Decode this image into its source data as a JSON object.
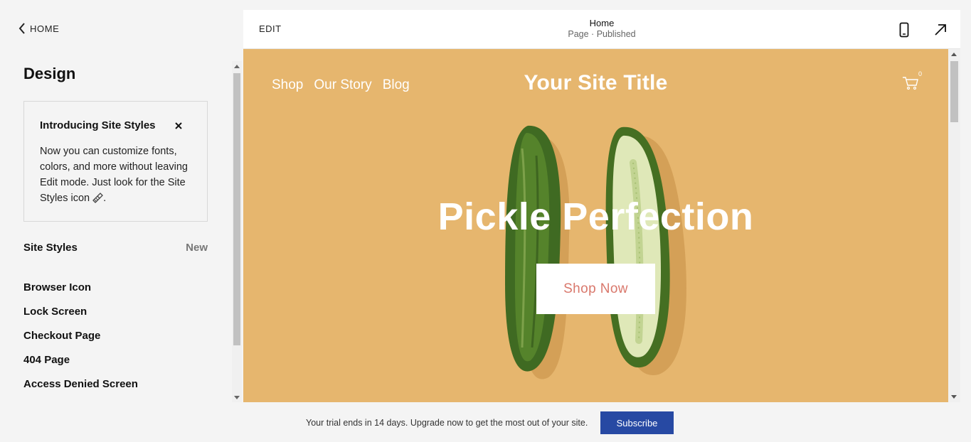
{
  "sidebar": {
    "back_label": "HOME",
    "title": "Design",
    "intro": {
      "title": "Introducing Site Styles",
      "body": "Now you can customize fonts, colors, and more without leaving Edit mode. Just look for the Site Styles icon",
      "body_end": "."
    },
    "site_styles": {
      "label": "Site Styles",
      "badge": "New"
    },
    "items": [
      {
        "label": "Browser Icon"
      },
      {
        "label": "Lock Screen"
      },
      {
        "label": "Checkout Page"
      },
      {
        "label": "404 Page"
      },
      {
        "label": "Access Denied Screen"
      }
    ]
  },
  "preview": {
    "edit_label": "EDIT",
    "page_name": "Home",
    "page_status": "Page · Published",
    "site": {
      "nav": [
        "Shop",
        "Our Story",
        "Blog"
      ],
      "title": "Your Site Title",
      "cart_count": "0",
      "headline": "Pickle Perfection",
      "cta": "Shop Now"
    }
  },
  "trial": {
    "text": "Your trial ends in 14 days. Upgrade now to get the most out of your site.",
    "button": "Subscribe"
  },
  "colors": {
    "hero_bg": "#e6b66e",
    "cta_text": "#d9786c",
    "subscribe_bg": "#2749a3"
  }
}
